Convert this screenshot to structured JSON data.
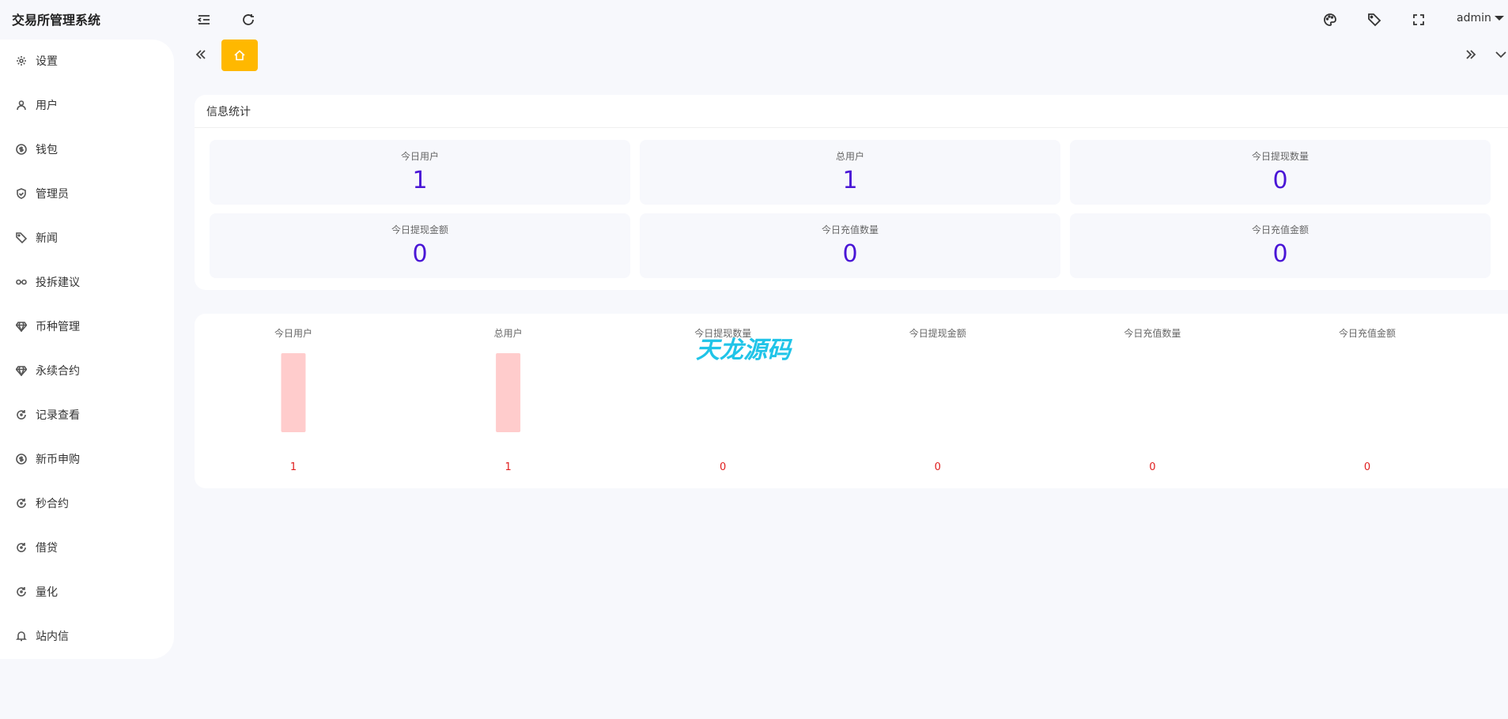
{
  "header": {
    "title": "交易所管理系统",
    "user_name": "admin",
    "icons": [
      "menu-fold-icon",
      "refresh-icon",
      "palette-icon",
      "tag-icon",
      "fullscreen-icon"
    ]
  },
  "sidebar": {
    "items": [
      {
        "label": "设置",
        "icon": "gear-icon"
      },
      {
        "label": "用户",
        "icon": "user-icon"
      },
      {
        "label": "钱包",
        "icon": "dollar-icon"
      },
      {
        "label": "管理员",
        "icon": "shield-icon"
      },
      {
        "label": "新闻",
        "icon": "tag-icon"
      },
      {
        "label": "投拆建议",
        "icon": "link-icon"
      },
      {
        "label": "币种管理",
        "icon": "diamond-icon"
      },
      {
        "label": "永续合约",
        "icon": "diamond-icon"
      },
      {
        "label": "记录查看",
        "icon": "rotate-icon"
      },
      {
        "label": "新币申购",
        "icon": "dollar-icon"
      },
      {
        "label": "秒合约",
        "icon": "rotate-icon"
      },
      {
        "label": "借贷",
        "icon": "rotate-icon"
      },
      {
        "label": "量化",
        "icon": "rotate-icon"
      },
      {
        "label": "站内信",
        "icon": "bell-icon"
      }
    ]
  },
  "tabs": {
    "home_icon": "home-icon"
  },
  "stats": {
    "title": "信息统计",
    "boxes": [
      {
        "label": "今日用户",
        "value": "1"
      },
      {
        "label": "总用户",
        "value": "1"
      },
      {
        "label": "今日提现数量",
        "value": "0"
      },
      {
        "label": "今日提现金额",
        "value": "0"
      },
      {
        "label": "今日充值数量",
        "value": "0"
      },
      {
        "label": "今日充值金额",
        "value": "0"
      }
    ]
  },
  "chart_data": {
    "type": "bar",
    "categories": [
      "今日用户",
      "总用户",
      "今日提现数量",
      "今日提现金额",
      "今日充值数量",
      "今日充值金额"
    ],
    "values": [
      1,
      1,
      0,
      0,
      0,
      0
    ],
    "title": "",
    "xlabel": "",
    "ylabel": "",
    "bar_color": "#ffcccc",
    "label_color": "#e02020"
  },
  "watermark": "天龙源码"
}
